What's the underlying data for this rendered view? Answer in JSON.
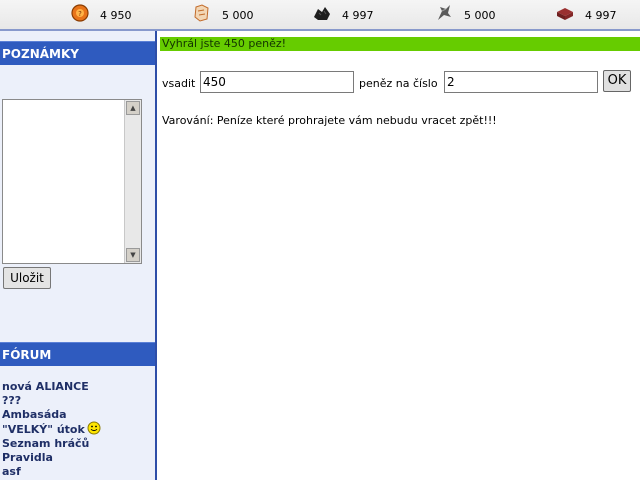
{
  "resources": [
    {
      "icon": "orange-coin-icon",
      "value": "4 950"
    },
    {
      "icon": "stone-bag-icon",
      "value": "5 000"
    },
    {
      "icon": "coal-pile-icon",
      "value": "4 997"
    },
    {
      "icon": "iron-ore-icon",
      "value": "5 000"
    },
    {
      "icon": "brick-icon",
      "value": "4 997"
    }
  ],
  "sidebar": {
    "notes_title": "POZNÁMKY",
    "notes_value": "",
    "save_label": "Uložit",
    "forum_title": "FÓRUM",
    "forum_items": [
      "nová ALIANCE",
      "???",
      "Ambasáda",
      "\"VELKÝ\" útok",
      "Seznam hráčů",
      "Pravidla",
      "asf"
    ]
  },
  "main": {
    "result_message": "Vyhrál jste 450 peněz!",
    "bet_label": "vsadit",
    "bet_value": "450",
    "number_label": "peněz na číslo",
    "number_value": "2",
    "ok_label": "OK",
    "warning": "Varování: Peníze které prohrajete vám nebudu vracet zpět!!!"
  },
  "colors": {
    "header_blue": "#2f5bbf",
    "success_green": "#66cc00",
    "sidebar_bg": "#ecf0fa",
    "link_color": "#1f2f66"
  }
}
